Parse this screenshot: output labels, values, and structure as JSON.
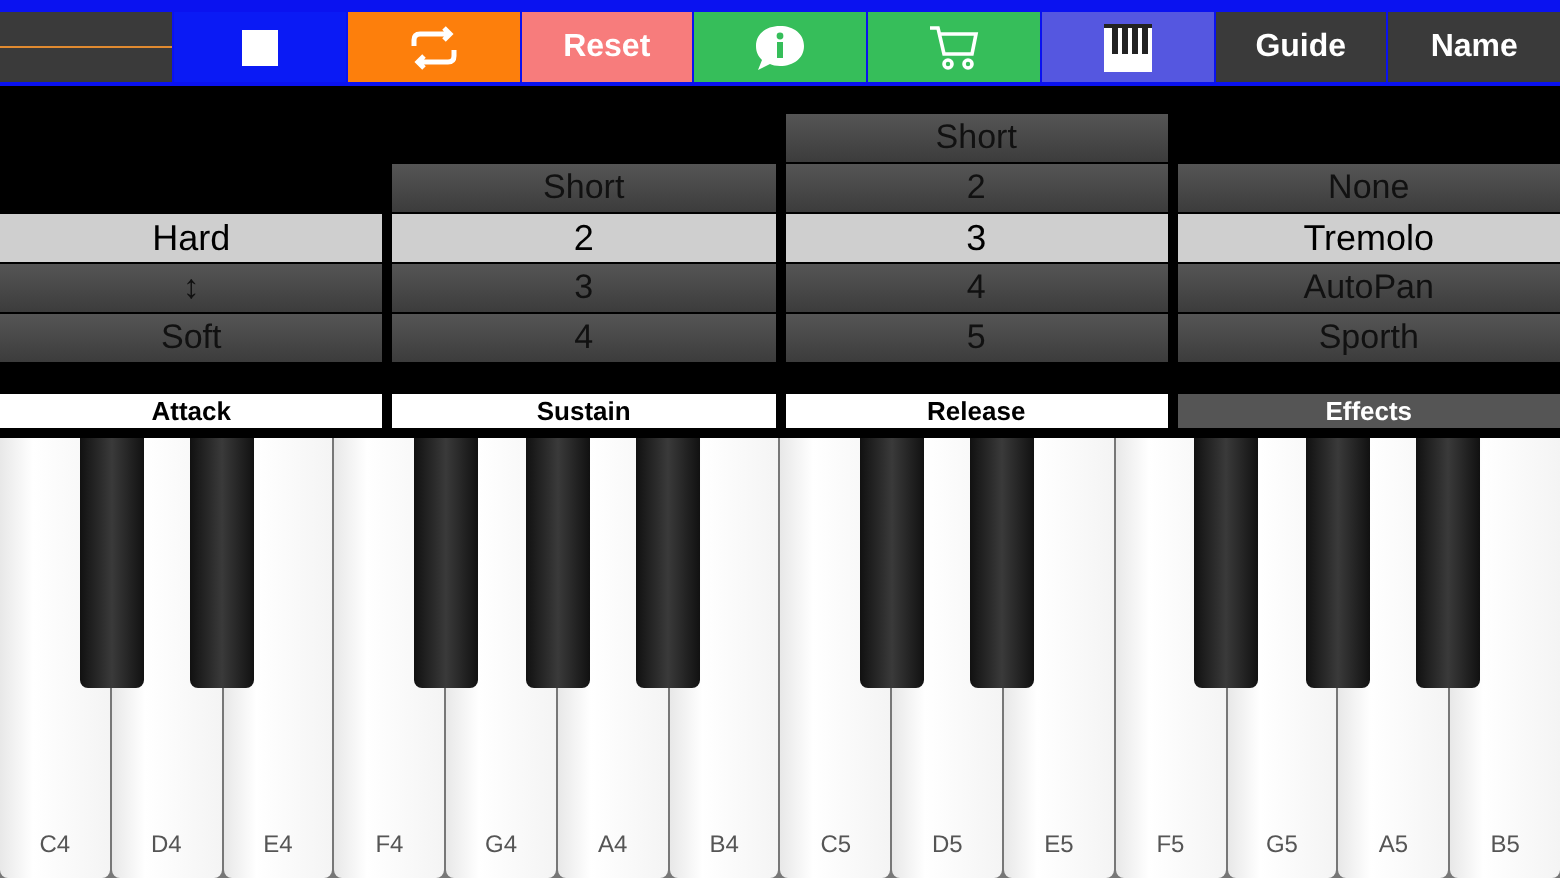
{
  "toolbar": {
    "buttons": [
      {
        "kind": "stop",
        "color": "#0a1af5"
      },
      {
        "kind": "loop",
        "color": "#fd7f0c"
      },
      {
        "kind": "text",
        "label": "Reset",
        "color": "#f77c7c"
      },
      {
        "kind": "info",
        "color": "#36be5a"
      },
      {
        "kind": "cart",
        "color": "#36be5a"
      },
      {
        "kind": "piano",
        "color": "#5557e0"
      },
      {
        "kind": "text",
        "label": "Guide",
        "color": "#3a3a3a"
      },
      {
        "kind": "text",
        "label": "Name",
        "color": "#3a3a3a"
      }
    ]
  },
  "pickers": [
    {
      "items": [
        {
          "label": "Hard",
          "selected": true
        },
        {
          "label": "↕",
          "selected": false
        },
        {
          "label": "Soft",
          "selected": false
        }
      ],
      "tab": {
        "label": "Attack",
        "selected": false
      }
    },
    {
      "items": [
        {
          "label": "Short",
          "selected": false
        },
        {
          "label": "2",
          "selected": true
        },
        {
          "label": "3",
          "selected": false
        },
        {
          "label": "4",
          "selected": false
        }
      ],
      "tab": {
        "label": "Sustain",
        "selected": false
      }
    },
    {
      "items": [
        {
          "label": "Short",
          "selected": false
        },
        {
          "label": "2",
          "selected": false
        },
        {
          "label": "3",
          "selected": true
        },
        {
          "label": "4",
          "selected": false
        },
        {
          "label": "5",
          "selected": false
        }
      ],
      "tab": {
        "label": "Release",
        "selected": false
      }
    },
    {
      "items": [
        {
          "label": "None",
          "selected": false
        },
        {
          "label": "Tremolo",
          "selected": true
        },
        {
          "label": "AutoPan",
          "selected": false
        },
        {
          "label": "Sporth",
          "selected": false
        }
      ],
      "tab": {
        "label": "Effects",
        "selected": true
      }
    }
  ],
  "keyboard": {
    "white_keys": [
      "C4",
      "D4",
      "E4",
      "F4",
      "G4",
      "A4",
      "B4",
      "C5",
      "D5",
      "E5",
      "F5",
      "G5",
      "A5",
      "B5"
    ]
  }
}
